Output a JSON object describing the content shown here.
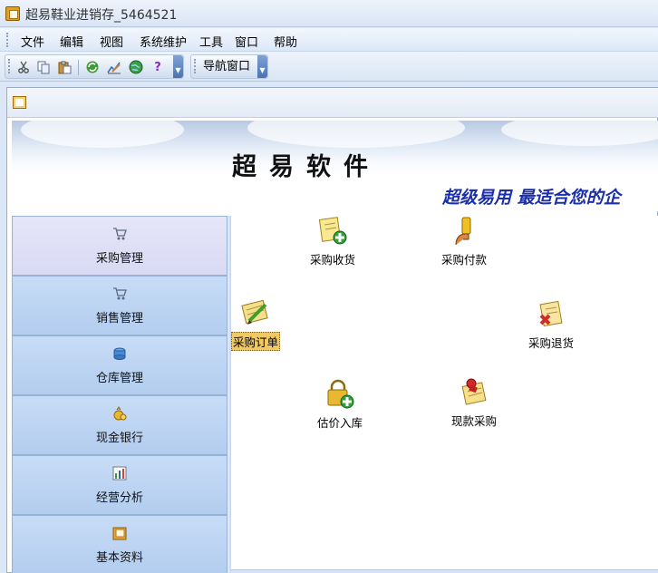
{
  "window": {
    "title": "超易鞋业进销存_5464521"
  },
  "menu": {
    "items": [
      {
        "label": "文件"
      },
      {
        "label": "编辑"
      },
      {
        "label": "视图"
      },
      {
        "label": "系统维护"
      },
      {
        "label": "工具"
      },
      {
        "label": "窗口"
      },
      {
        "label": "帮助"
      }
    ]
  },
  "toolbar": {
    "buttons": [
      "cut-icon",
      "copy-icon",
      "paste-icon",
      "refresh-icon",
      "chart-edit-icon",
      "globe-icon",
      "help-icon"
    ],
    "nav_window_label": "导航窗口"
  },
  "banner": {
    "title": "超易软件",
    "slogan": "超级易用  最适合您的企"
  },
  "nav": {
    "items": [
      {
        "label": "采购管理",
        "icon": "cart-icon",
        "active": true
      },
      {
        "label": "销售管理",
        "icon": "cart-icon",
        "active": false
      },
      {
        "label": "仓库管理",
        "icon": "warehouse-icon",
        "active": false
      },
      {
        "label": "现金银行",
        "icon": "money-bag-icon",
        "active": false
      },
      {
        "label": "经营分析",
        "icon": "bar-chart-icon",
        "active": false
      },
      {
        "label": "基本资料",
        "icon": "folder-icon",
        "active": false
      }
    ]
  },
  "functions": [
    {
      "label": "采购收货",
      "icon": "document-add-icon"
    },
    {
      "label": "采购付款",
      "icon": "payment-hand-icon"
    },
    {
      "label": "采购订单",
      "icon": "order-pencil-icon",
      "selected": true
    },
    {
      "label": "采购退货",
      "icon": "document-delete-icon"
    },
    {
      "label": "估价入库",
      "icon": "lock-add-icon"
    },
    {
      "label": "现款采购",
      "icon": "cash-purchase-icon"
    }
  ]
}
